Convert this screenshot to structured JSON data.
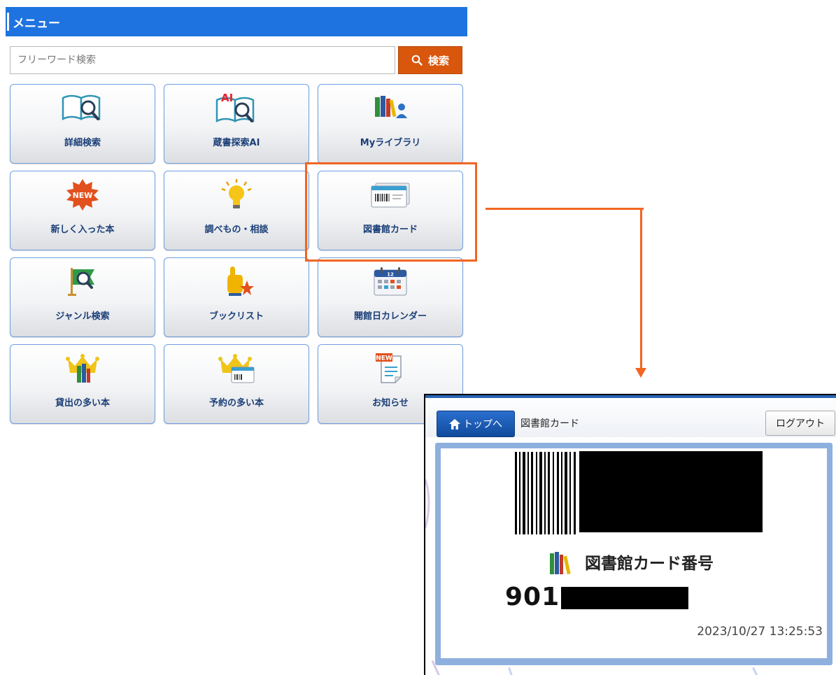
{
  "menu": {
    "title": "メニュー",
    "search": {
      "placeholder": "フリーワード検索",
      "button_label": "検索"
    },
    "tiles": [
      {
        "label": "詳細検索",
        "icon": "open-book-magnifier-icon"
      },
      {
        "label": "蔵書探索AI",
        "icon": "ai-book-magnifier-icon"
      },
      {
        "label": "Myライブラリ",
        "icon": "books-user-icon"
      },
      {
        "label": "新しく入った本",
        "icon": "new-badge-icon"
      },
      {
        "label": "調べもの・相談",
        "icon": "lightbulb-icon"
      },
      {
        "label": "図書館カード",
        "icon": "library-card-icon"
      },
      {
        "label": "ジャンル検索",
        "icon": "flag-magnifier-icon"
      },
      {
        "label": "ブックリスト",
        "icon": "pointing-hand-star-icon"
      },
      {
        "label": "開館日カレンダー",
        "icon": "calendar-icon"
      },
      {
        "label": "貸出の多い本",
        "icon": "crown-books-icon"
      },
      {
        "label": "予約の多い本",
        "icon": "crown-card-icon"
      },
      {
        "label": "お知らせ",
        "icon": "new-document-icon"
      }
    ],
    "calendar_day": "12",
    "new_badge": "NEW",
    "ai_badge": "AI"
  },
  "card_screen": {
    "top_button_label": "トップへ",
    "title": "図書館カード",
    "logout_label": "ログアウト",
    "card_number_label": "図書館カード番号",
    "card_number_prefix": "901",
    "timestamp": "2023/10/27 13:25:53"
  },
  "colors": {
    "header_blue": "#1e73e0",
    "search_orange": "#d9570c",
    "highlight_orange": "#f26522",
    "tile_label": "#1b3f78"
  }
}
